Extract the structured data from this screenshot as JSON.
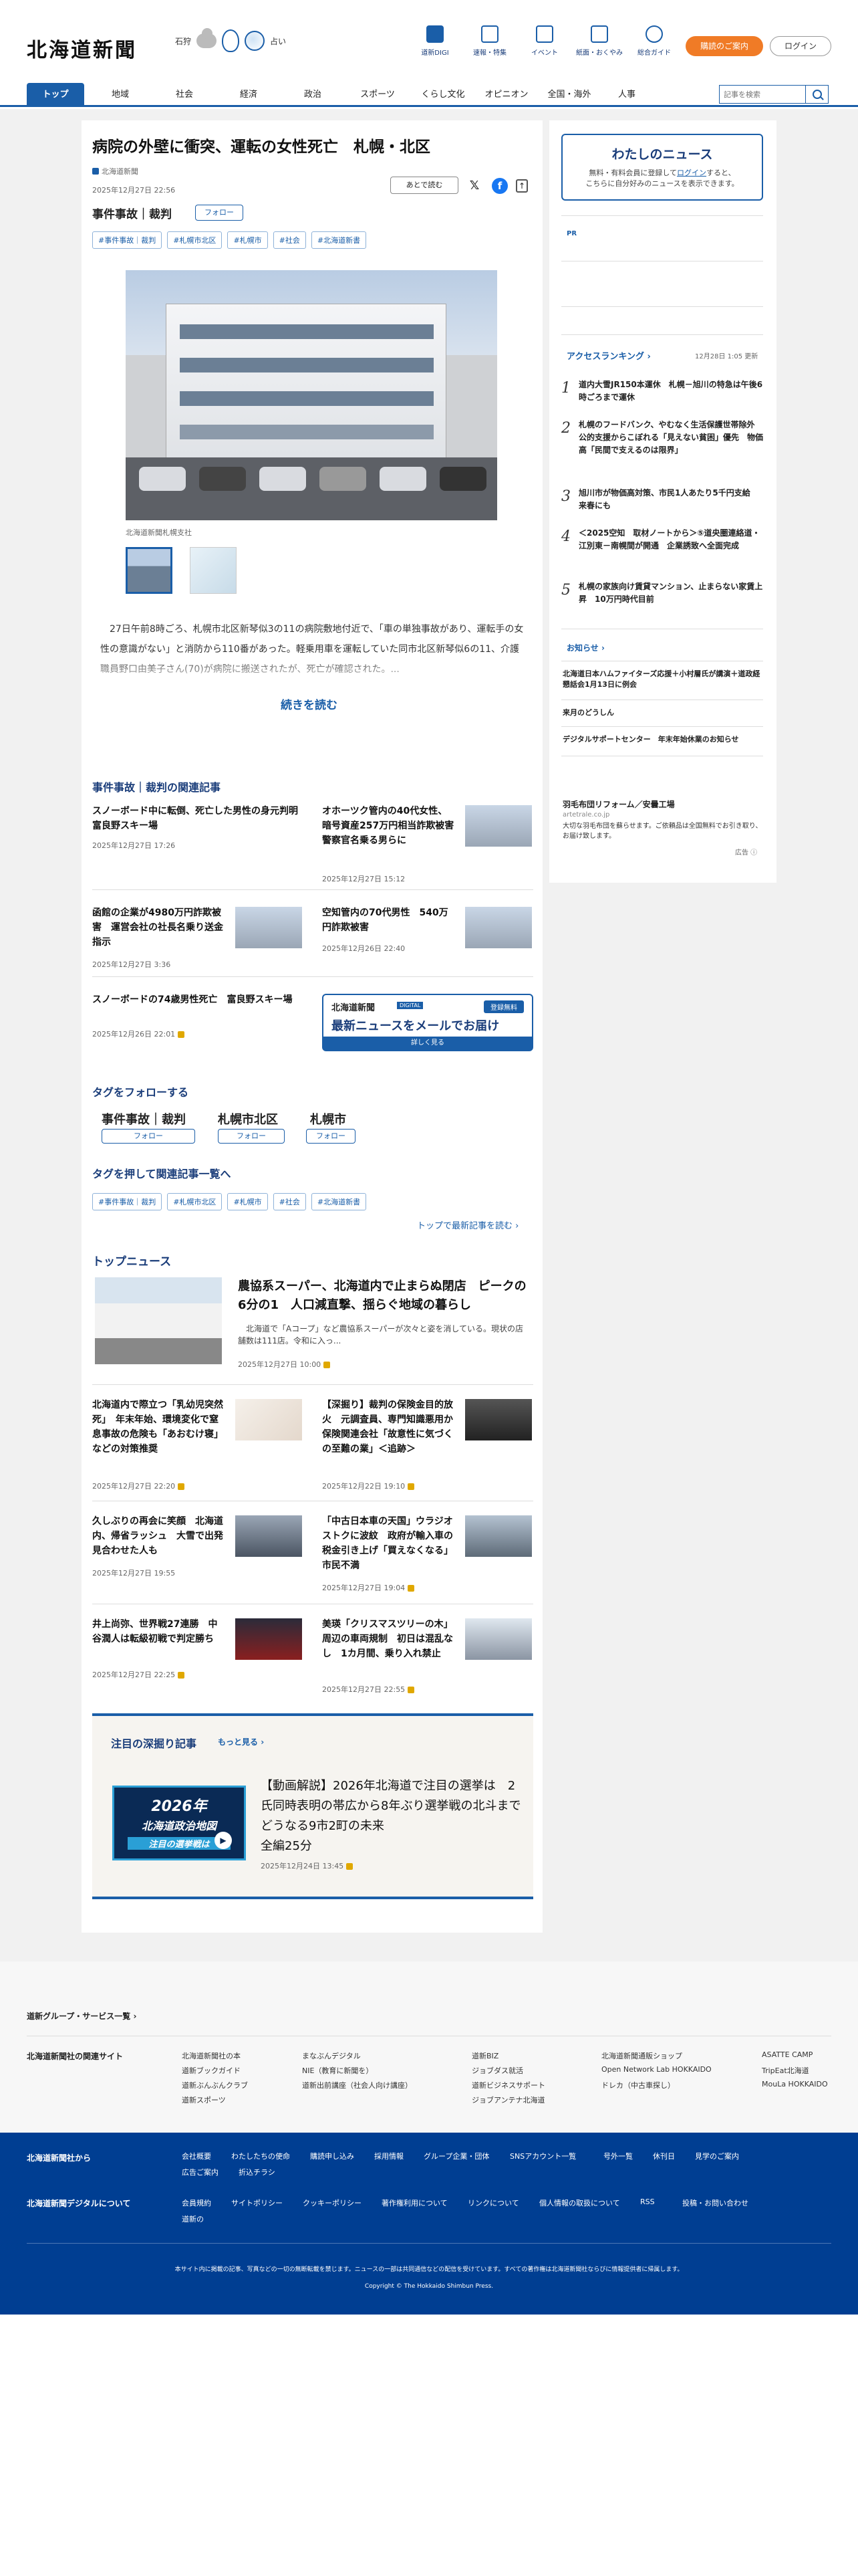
{
  "header": {
    "logo": "北海道新聞",
    "region": "石狩",
    "weather_note": "占い",
    "icons": [
      {
        "label": "道新DIGI",
        "icon": "book-icon"
      },
      {
        "label": "速報・特集",
        "icon": "flag-icon"
      },
      {
        "label": "イベント",
        "icon": "calendar-icon"
      },
      {
        "label": "紙面・おくやみ",
        "icon": "newspaper-icon"
      },
      {
        "label": "総合ガイド",
        "icon": "help-icon"
      }
    ],
    "subscribe": "購読のご案内",
    "login": "ログイン",
    "search_placeholder": "記事を検索"
  },
  "nav": [
    "トップ",
    "地域",
    "社会",
    "経済",
    "政治",
    "スポーツ",
    "くらし文化",
    "オピニオン",
    "全国・海外",
    "人事"
  ],
  "article": {
    "title": "病院の外壁に衝突、運転の女性死亡　札幌・北区",
    "source": "北海道新聞",
    "date": "2025年12月27日 22:56",
    "read_later": "あとで読む",
    "category": "事件事故｜裁判",
    "follow": "フォロー",
    "tags": [
      "#事件事故｜裁判",
      "#札幌市北区",
      "#札幌市",
      "#社会",
      "#北海道新書"
    ],
    "caption": "北海道新聞札幌支社",
    "lead": "　27日午前8時ごろ、札幌市北区新琴似3の11の病院敷地付近で、「車の単独事故があり、運転手の女性の意識がない」と消防から110番があった。軽乗用車を運転していた同市北区新琴似6の11、介護職員野口由美子さん(70)が病院に搬送されたが、死亡が確認された。...",
    "read_more": "続きを読む"
  },
  "related": {
    "title": "事件事故｜裁判の関連記事",
    "items": [
      {
        "title": "スノーボード中に転倒、死亡した男性の身元判明　富良野スキー場",
        "date": "2025年12月27日 17:26",
        "img": false
      },
      {
        "title": "オホーツク管内の40代女性、暗号資産257万円相当詐欺被害　警察官名乗る男らに",
        "date": "2025年12月27日 15:12",
        "img": true
      },
      {
        "title": "函館の企業が4980万円詐欺被害　運営会社の社長名乗り送金指示",
        "date": "2025年12月27日 3:36",
        "img": true
      },
      {
        "title": "空知管内の70代男性　540万円詐欺被害",
        "date": "2025年12月26日 22:40",
        "img": true
      },
      {
        "title": "スノーボードの74歳男性死亡　富良野スキー場",
        "date": "2025年12月26日 22:01",
        "img": false
      }
    ],
    "banner": {
      "brand": "北海道新聞",
      "tag": "DIGITAL",
      "free": "登録無料",
      "text": "最新ニュースをメールでお届け",
      "more": "詳しく見る"
    }
  },
  "tag_follow": {
    "title": "タグをフォローする",
    "tags": [
      "事件事故｜裁判",
      "札幌市北区",
      "札幌市"
    ],
    "follow": "フォロー"
  },
  "tag_push": {
    "title": "タグを押して関連記事一覧へ",
    "tags": [
      "#事件事故｜裁判",
      "#札幌市北区",
      "#札幌市",
      "#社会",
      "#北海道新書"
    ],
    "more": "トップで最新記事を読む"
  },
  "top_news": {
    "title": "トップニュース",
    "lead": {
      "title": "農協系スーパー、北海道内で止まらぬ閉店　ピークの6分の1　人口減直撃、揺らぐ地域の暮らし",
      "summary": "　北海道で「Aコープ」など農協系スーパーが次々と姿を消している。現状の店舗数は111店。令和に入っ...",
      "date": "2025年12月27日 10:00"
    },
    "items": [
      {
        "title": "北海道内で際立つ「乳幼児突然死」　年末年始、環境変化で窒息事故の危険も「あおむけ寝」などの対策推奨",
        "date": "2025年12月27日 22:20"
      },
      {
        "title": "【深掘り】裁判の保険金目的放火　元調査員、専門知識悪用か　保険関連会社「故意性に気づくの至難の業」＜追跡＞",
        "date": "2025年12月22日 19:10"
      },
      {
        "title": "久しぶりの再会に笑顔　北海道内、帰省ラッシュ　大雪で出発見合わせた人も",
        "date": "2025年12月27日 19:55"
      },
      {
        "title": "「中古日本車の天国」ウラジオストクに波紋　政府が輸入車の税金引き上げ「買えなくなる」市民不満",
        "date": "2025年12月27日 19:04"
      },
      {
        "title": "井上尚弥、世界戦27連勝　中谷潤人は転級初戦で判定勝ち",
        "date": "2025年12月27日 22:25"
      },
      {
        "title": "美瑛「クリスマスツリーの木」周辺の車両規制　初日は混乱なし　1カ月間、乗り入れ禁止",
        "date": "2025年12月27日 22:55"
      }
    ]
  },
  "deep": {
    "title": "注目の深掘り記事",
    "more": "もっと見る",
    "thumb_year": "2026年",
    "thumb_line1": "北海道政治地図",
    "thumb_line2": "注目の選挙戦は",
    "headline": "【動画解説】2026年北海道で注目の選挙は　2氏同時表明の帯広から8年ぶり選挙戦の北斗まで　どうなる9市2町の未来",
    "series": "全編25分",
    "date": "2025年12月24日 13:45"
  },
  "sidebar": {
    "my_news_title": "わたしのニュース",
    "my_news_desc1": "無料・有料会員に登録して",
    "my_news_login": "ログイン",
    "my_news_desc2": "すると、",
    "my_news_desc3": "こちらに自分好みのニュースを表示できます。",
    "pr": "PR",
    "ranking_title": "アクセスランキング",
    "ranking_updated": "12月28日 1:05 更新",
    "ranking": [
      "道内大雪JR150本運休　札幌－旭川の特急は午後6時ごろまで運休",
      "札幌のフードバンク、やむなく生活保護世帯除外　公的支援からこぼれる「見えない貧困」優先　物価高「民間で支えるのは限界」",
      "旭川市が物価高対策、市民1人あたり5千円支給　来春にも",
      "＜2025空知　取材ノートから＞⑤道央圏連絡道・江別東－南幌間が開通　企業誘致へ全面完成",
      "札幌の家族向け賃貸マンション、止まらない家賃上昇　10万円時代目前"
    ],
    "notice_title": "お知らせ",
    "notices": [
      "北海道日本ハムファイターズ応援＋小村層氏が講演＋道政経懇話会1月13日に例会",
      "来月のどうしん",
      "デジタルサポートセンター　年末年始休業のお知らせ"
    ],
    "ad_title": "羽毛布団リフォーム／安曇工場",
    "ad_url": "artetrale.co.jp",
    "ad_desc": "大切な羽毛布団を蘇らせます。ご依頼品は全国無料でお引き取り、お届け致します。",
    "ad_label": "広告"
  },
  "footer": {
    "group_title": "道新グループ・サービス一覧",
    "sites_title": "北海道新聞社の関連サイト",
    "sites": [
      [
        "北海道新聞社の本",
        "道新ブックガイド",
        "道新ぶんぶんクラブ",
        "道新スポーツ"
      ],
      [
        "まなぶんデジタル",
        "NIE（教育に新聞を）",
        "道新出前講座（社会人向け講座）"
      ],
      [
        "道新BIZ",
        "ジョブダス就活",
        "道新ビジネスサポート",
        "ジョブアンテナ北海道"
      ],
      [
        "北海道新聞通販ショップ",
        "Open Network Lab HOKKAIDO",
        "ドレカ（中古車探し）"
      ],
      [
        "ASATTE CAMP",
        "TripEat北海道",
        "MouLa HOKKAIDO"
      ]
    ],
    "company_title": "北海道新聞社から",
    "company_links": [
      "会社概要",
      "わたしたちの使命",
      "購読申し込み",
      "採用情報",
      "グループ企業・団体",
      "SNSアカウント一覧",
      "号外一覧",
      "休刊日",
      "見学のご案内",
      "広告ご案内",
      "折込チラシ"
    ],
    "digital_title": "北海道新聞デジタルについて",
    "digital_links": [
      "会員規約",
      "サイトポリシー",
      "クッキーポリシー",
      "著作権利用について",
      "リンクについて",
      "個人情報の取扱について",
      "RSS",
      "投稿・お問い合わせ",
      "道新の"
    ],
    "copyright_note": "本サイト内に掲載の記事、写真などの一切の無断転載を禁じます。ニュースの一部は共同通信などの配信を受けています。すべての著作権は北海道新聞社ならびに情報提供者に帰属します。",
    "copyright": "Copyright © The Hokkaido Shimbun Press."
  }
}
